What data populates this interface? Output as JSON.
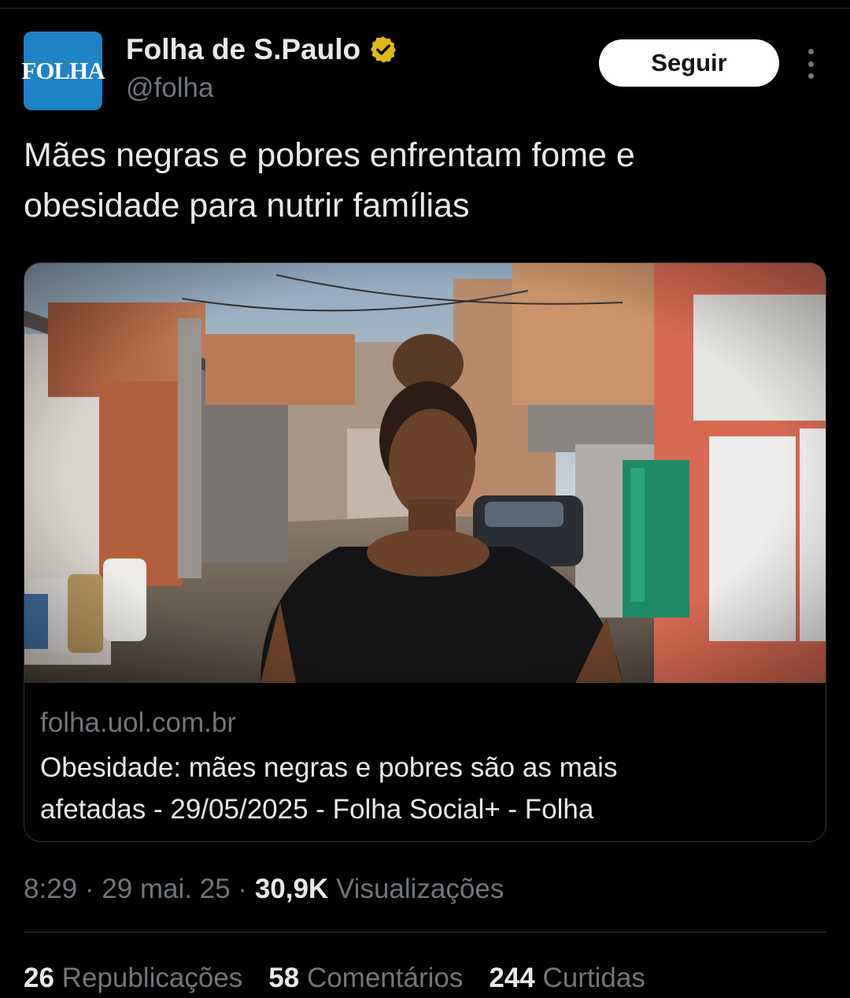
{
  "tweet": {
    "author": {
      "avatar_text": "FOLHA",
      "display_name": "Folha de S.Paulo",
      "handle": "@folha",
      "verified_icon": "verified-gold-badge-icon"
    },
    "follow_label": "Seguir",
    "more_icon": "more-vertical-icon",
    "text_line1": "Mães negras e pobres enfrentam fome e",
    "text_line2": "obesidade para nutrir famílias",
    "card": {
      "image_description_icon": "article-photo",
      "domain": "folha.uol.com.br",
      "title_line1": "Obesidade: mães negras e pobres são as mais",
      "title_line2": "afetadas - 29/05/2025 - Folha Social+ - Folha"
    },
    "meta": {
      "time": "8:29",
      "separator": "·",
      "date": "29 mai. 25",
      "views_count": "30,9K",
      "views_label": "Visualizações"
    },
    "stats": {
      "reposts_count": "26",
      "reposts_label": "Republicações",
      "comments_count": "58",
      "comments_label": "Comentários",
      "likes_count": "244",
      "likes_label": "Curtidas"
    }
  },
  "colors": {
    "background": "#000000",
    "text_primary": "#e7e9ea",
    "text_secondary": "#71767b",
    "avatar_blue": "#1e82c6",
    "verified_gold": "#e2b719",
    "divider": "#2f3336"
  }
}
